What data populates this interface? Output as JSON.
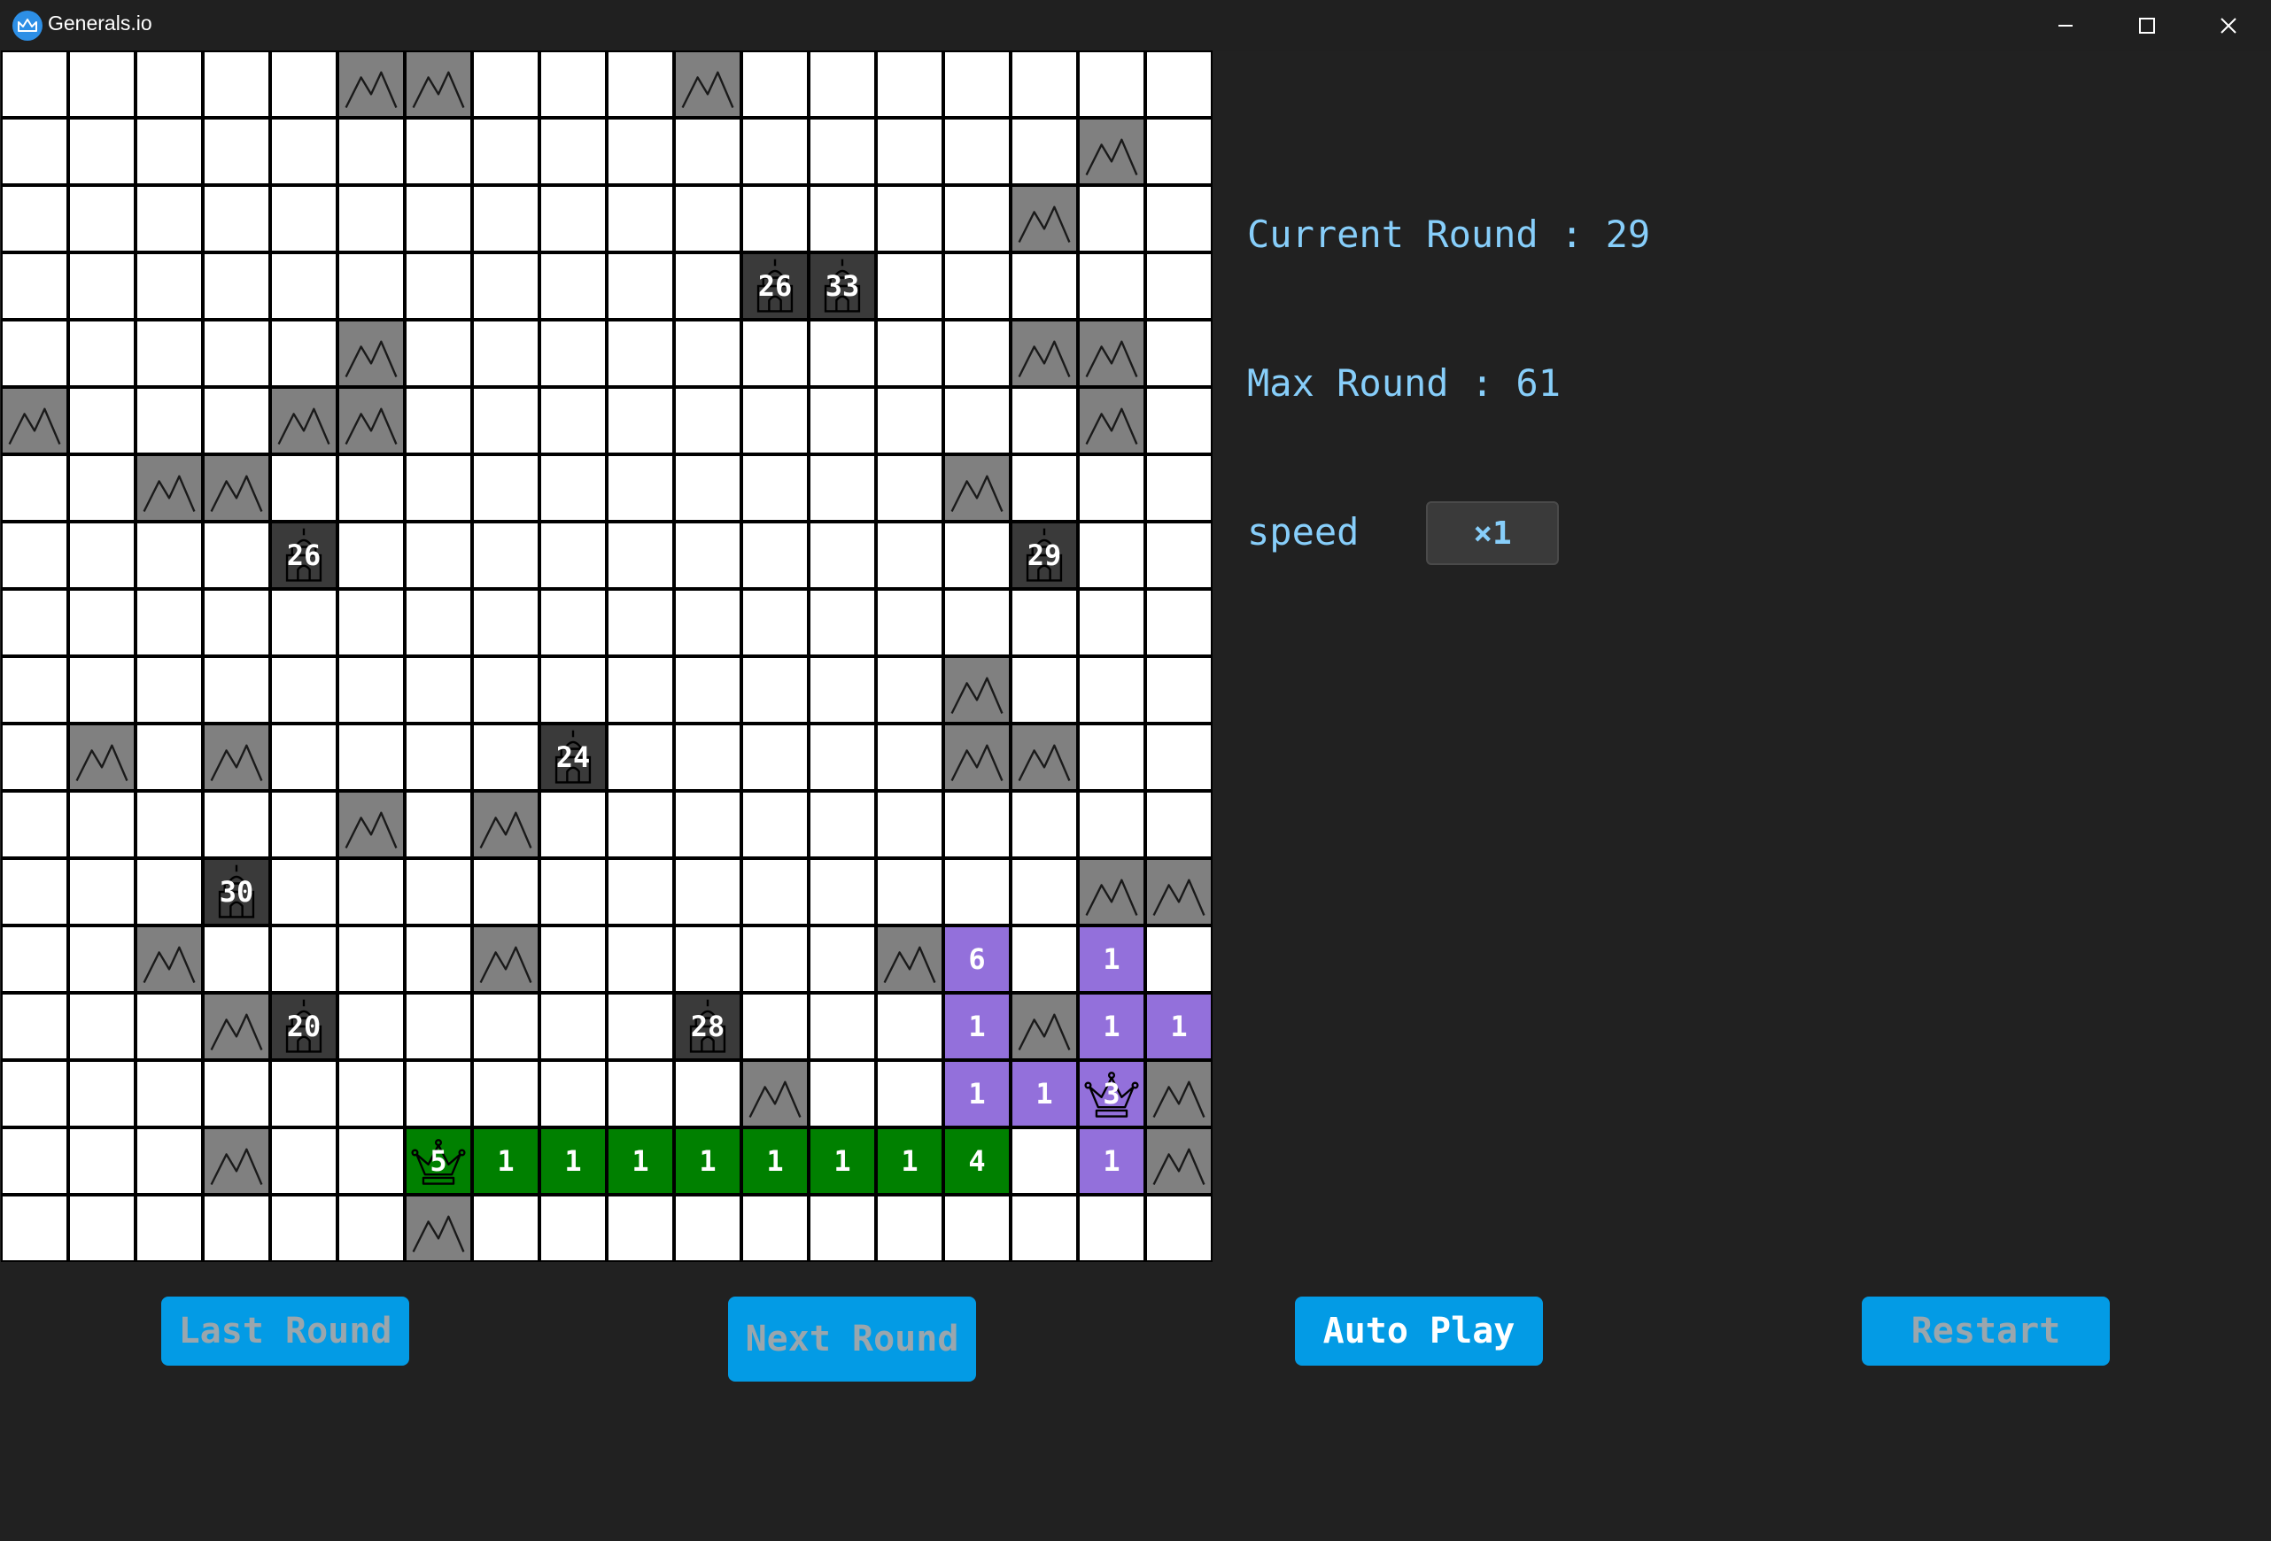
{
  "window": {
    "title": "Generals.io"
  },
  "info": {
    "current_round_label": "Current Round : 29",
    "max_round_label": "Max Round : 61",
    "speed_label": "speed",
    "speed_value": "×1"
  },
  "buttons": {
    "last_round": "Last Round",
    "next_round": "Next Round",
    "auto_play": "Auto Play",
    "restart": "Restart"
  },
  "colors": {
    "purple_player": "#9370db",
    "green_player": "#008000",
    "mountain": "#808080",
    "city": "#3a3a3a",
    "accent_button": "#039be5",
    "info_text": "#87cefa"
  },
  "board": {
    "rows": [
      [
        "",
        "",
        "",
        "",
        "",
        "M",
        "M",
        "",
        "",
        "",
        "M",
        "",
        "",
        "",
        "",
        "",
        "",
        ""
      ],
      [
        "",
        "",
        "",
        "",
        "",
        "",
        "",
        "",
        "",
        "",
        "",
        "",
        "",
        "",
        "",
        "",
        "M",
        ""
      ],
      [
        "",
        "",
        "",
        "",
        "",
        "",
        "",
        "",
        "",
        "",
        "",
        "",
        "",
        "",
        "",
        "M",
        "",
        ""
      ],
      [
        "",
        "",
        "",
        "",
        "",
        "",
        "",
        "",
        "",
        "",
        "",
        "C:26",
        "C:33",
        "",
        "",
        "",
        "",
        ""
      ],
      [
        "",
        "",
        "",
        "",
        "",
        "M",
        "",
        "",
        "",
        "",
        "",
        "",
        "",
        "",
        "",
        "M",
        "M",
        ""
      ],
      [
        "M",
        "",
        "",
        "",
        "M",
        "M",
        "",
        "",
        "",
        "",
        "",
        "",
        "",
        "",
        "",
        "",
        "M",
        ""
      ],
      [
        "",
        "",
        "M",
        "M",
        "",
        "",
        "",
        "",
        "",
        "",
        "",
        "",
        "",
        "",
        "M",
        "",
        "",
        ""
      ],
      [
        "",
        "",
        "",
        "",
        "C:26",
        "",
        "",
        "",
        "",
        "",
        "",
        "",
        "",
        "",
        "",
        "C:29",
        "",
        ""
      ],
      [
        "",
        "",
        "",
        "",
        "",
        "",
        "",
        "",
        "",
        "",
        "",
        "",
        "",
        "",
        "",
        "",
        "",
        ""
      ],
      [
        "",
        "",
        "",
        "",
        "",
        "",
        "",
        "",
        "",
        "",
        "",
        "",
        "",
        "",
        "M",
        "",
        "",
        ""
      ],
      [
        "",
        "M",
        "",
        "M",
        "",
        "",
        "",
        "",
        "C:24",
        "",
        "",
        "",
        "",
        "",
        "M",
        "M",
        "",
        ""
      ],
      [
        "",
        "",
        "",
        "",
        "",
        "M",
        "",
        "M",
        "",
        "",
        "",
        "",
        "",
        "",
        "",
        "",
        "",
        ""
      ],
      [
        "",
        "",
        "",
        "C:30",
        "",
        "",
        "",
        "",
        "",
        "",
        "",
        "",
        "",
        "",
        "",
        "",
        "M",
        "M"
      ],
      [
        "",
        "",
        "M",
        "",
        "",
        "",
        "",
        "M",
        "",
        "",
        "",
        "",
        "",
        "M",
        "P:6",
        "",
        "P:1",
        ""
      ],
      [
        "",
        "",
        "",
        "M",
        "C:20",
        "",
        "",
        "",
        "",
        "",
        "C:28",
        "",
        "",
        "",
        "P:1",
        "M",
        "P:1",
        "P:1"
      ],
      [
        "",
        "",
        "",
        "",
        "",
        "",
        "",
        "",
        "",
        "",
        "",
        "M",
        "",
        "",
        "P:1",
        "P:1",
        "PG:3",
        "M"
      ],
      [
        "",
        "",
        "",
        "M",
        "",
        "",
        "GG:5",
        "G:1",
        "G:1",
        "G:1",
        "G:1",
        "G:1",
        "G:1",
        "G:1",
        "G:4",
        "",
        "P:1",
        "M"
      ],
      [
        "",
        "",
        "",
        "",
        "",
        "",
        "M",
        "",
        "",
        "",
        "",
        "",
        "",
        "",
        "",
        "",
        "",
        ""
      ]
    ]
  }
}
